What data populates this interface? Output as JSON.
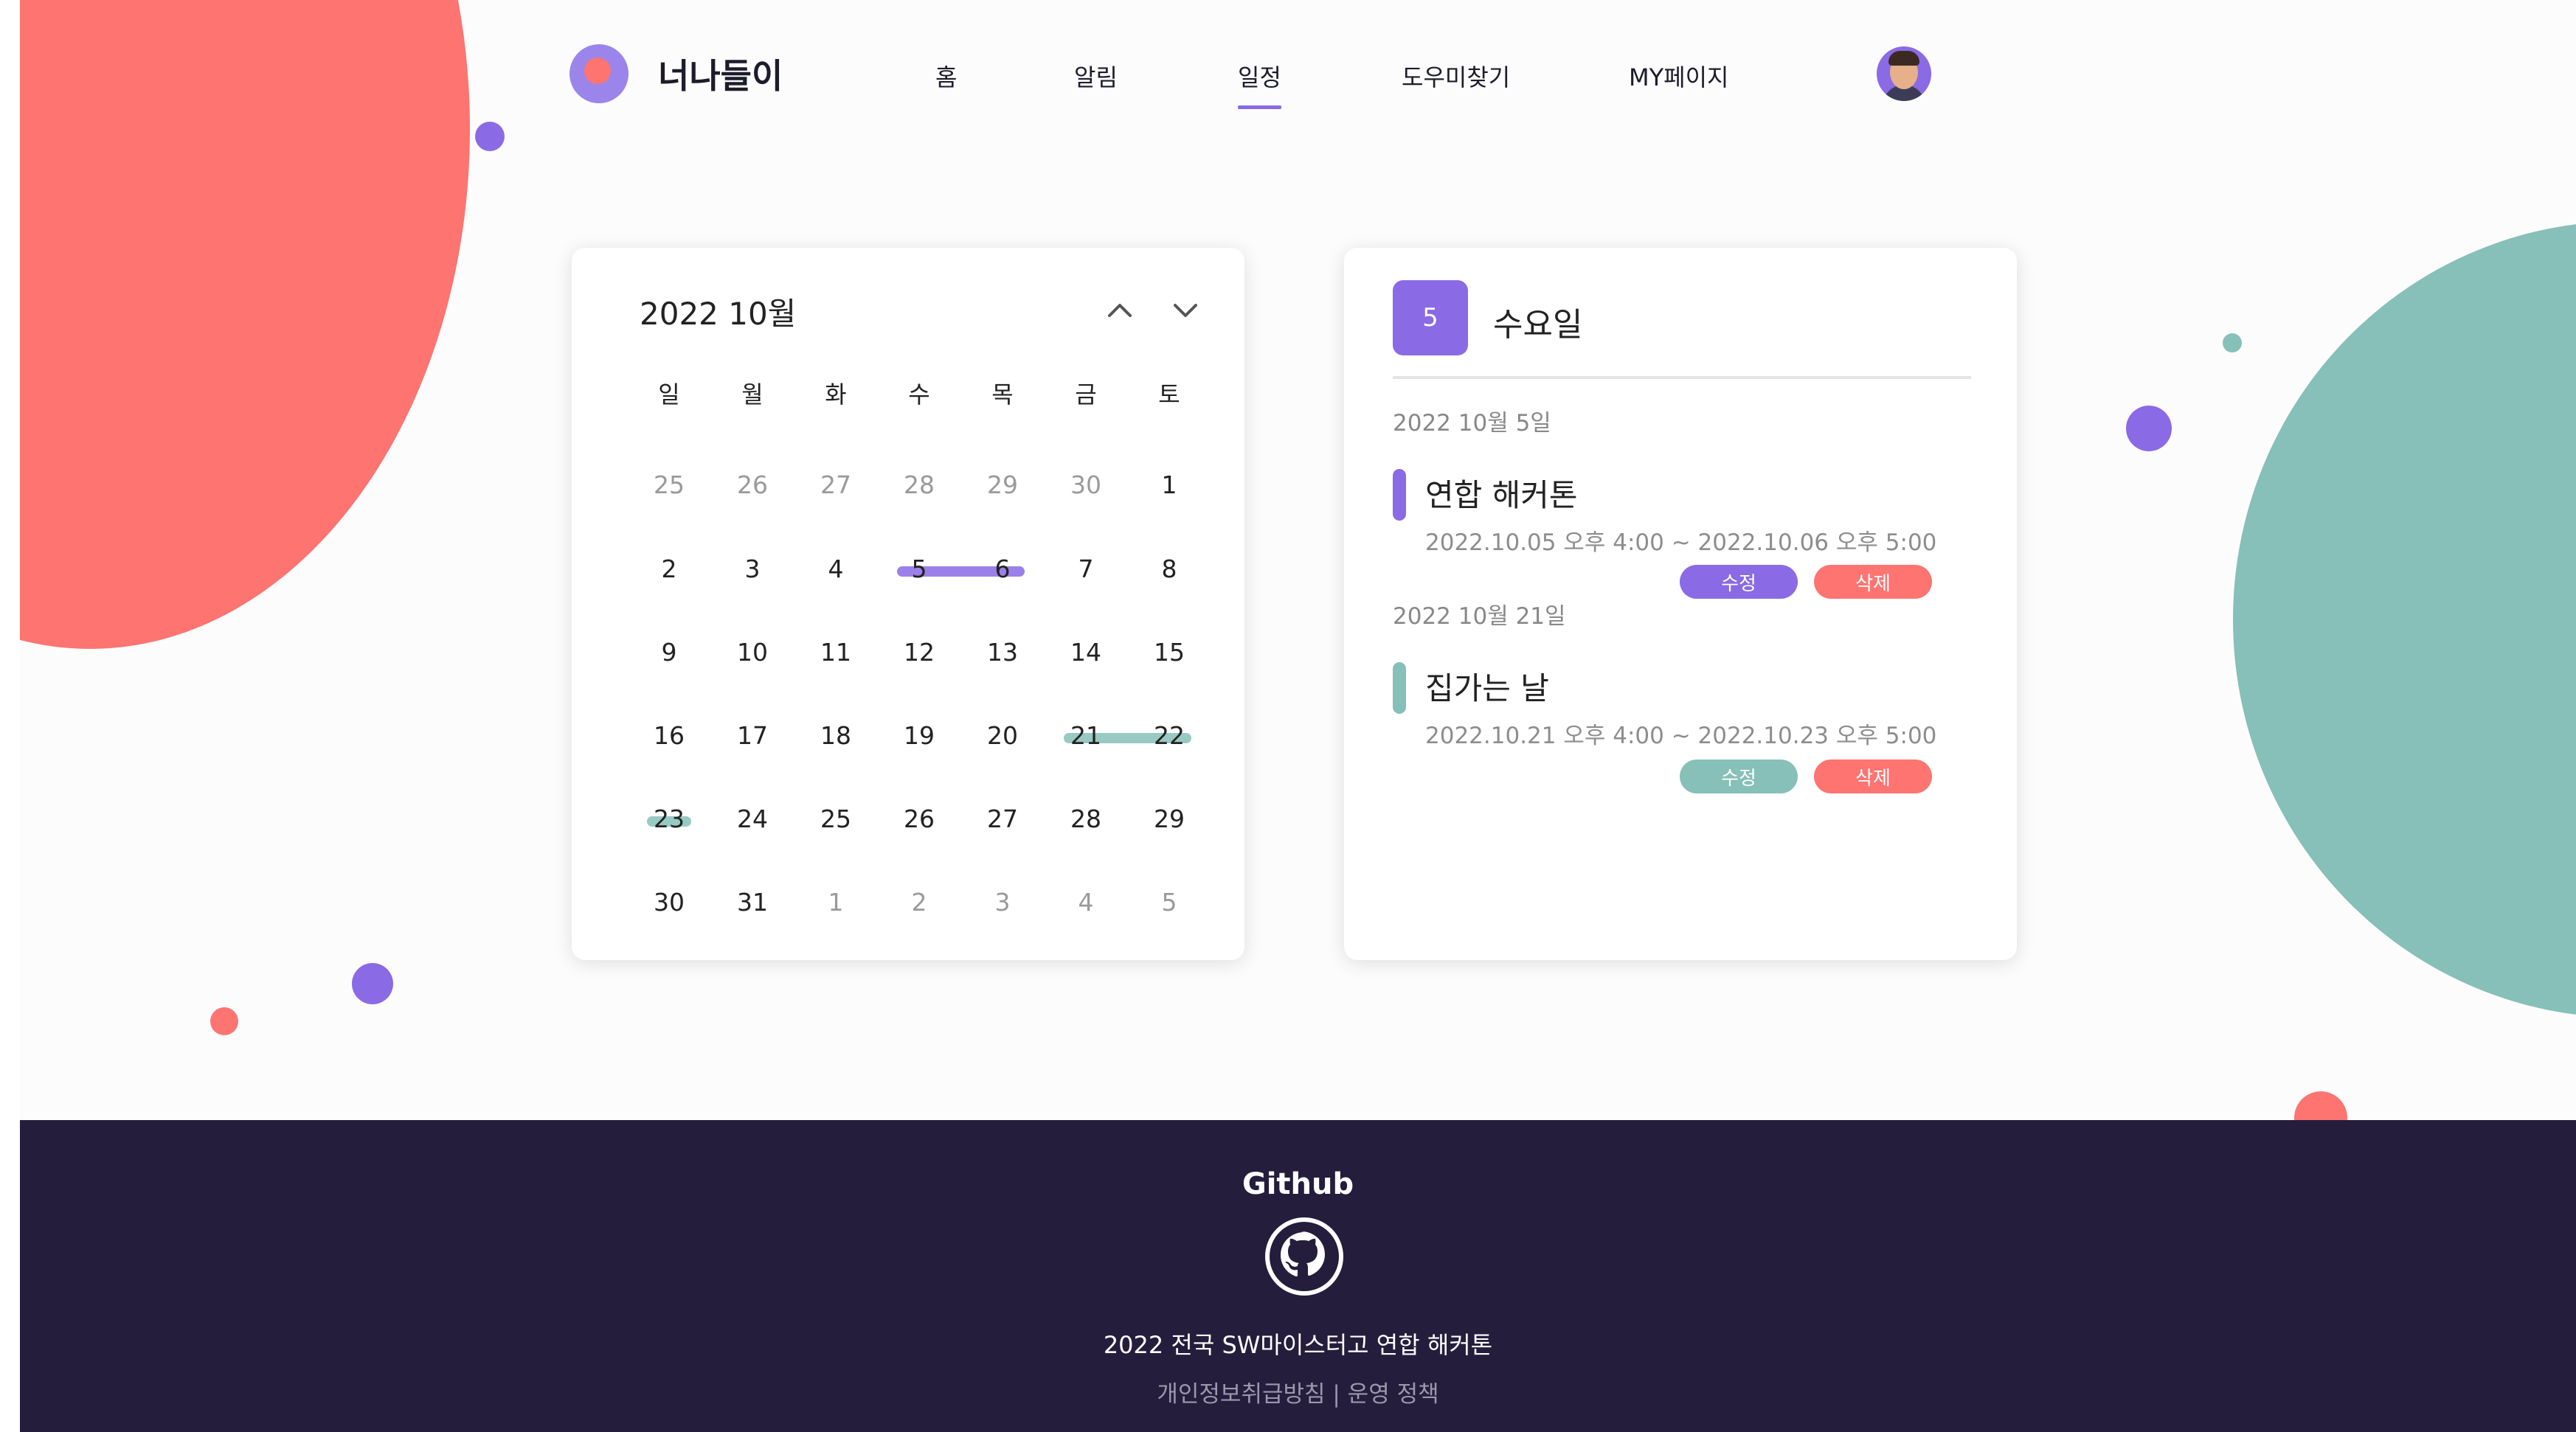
{
  "header": {
    "logo_text": "너나들이",
    "nav": [
      "홈",
      "알림",
      "일정",
      "도우미찾기",
      "MY페이지"
    ],
    "active_nav": "일정"
  },
  "calendar": {
    "title": "2022 10월",
    "weekdays": [
      "일",
      "월",
      "화",
      "수",
      "목",
      "금",
      "토"
    ],
    "weeks": [
      [
        "25",
        "26",
        "27",
        "28",
        "29",
        "30",
        "1"
      ],
      [
        "2",
        "3",
        "4",
        "5",
        "6",
        "7",
        "8"
      ],
      [
        "9",
        "10",
        "11",
        "12",
        "13",
        "14",
        "15"
      ],
      [
        "16",
        "17",
        "18",
        "19",
        "20",
        "21",
        "22"
      ],
      [
        "23",
        "24",
        "25",
        "26",
        "27",
        "28",
        "29"
      ],
      [
        "30",
        "31",
        "1",
        "2",
        "3",
        "4",
        "5"
      ]
    ],
    "muted": [
      [
        true,
        true,
        true,
        true,
        true,
        true,
        false
      ],
      [
        false,
        false,
        false,
        false,
        false,
        false,
        false
      ],
      [
        false,
        false,
        false,
        false,
        false,
        false,
        false
      ],
      [
        false,
        false,
        false,
        false,
        false,
        false,
        false
      ],
      [
        false,
        false,
        false,
        false,
        false,
        false,
        false
      ],
      [
        false,
        false,
        true,
        true,
        true,
        true,
        true
      ]
    ],
    "colors": {
      "purple": "#8a6ae5",
      "teal": "#86c0b8",
      "red": "#fd7470"
    }
  },
  "detail": {
    "day_number": "5",
    "weekday": "수요일",
    "groups": [
      {
        "date": "2022 10월 5일",
        "title": "연합 해커톤",
        "time": "2022.10.05 오후 4:00 ~ 2022.10.06 오후 5:00",
        "color": "#8a6ae5",
        "edit_label": "수정",
        "delete_label": "삭제"
      },
      {
        "date": "2022 10월 21일",
        "title": "집가는 날",
        "time": "2022.10.21 오후 4:00 ~ 2022.10.23 오후 5:00",
        "color": "#86c0b8",
        "edit_label": "수정",
        "delete_label": "삭제"
      }
    ]
  },
  "footer": {
    "title": "Github",
    "line1": "2022 전국 SW마이스터고 연합 해커톤",
    "line2": "개인정보취급방침 | 운영 정책"
  }
}
